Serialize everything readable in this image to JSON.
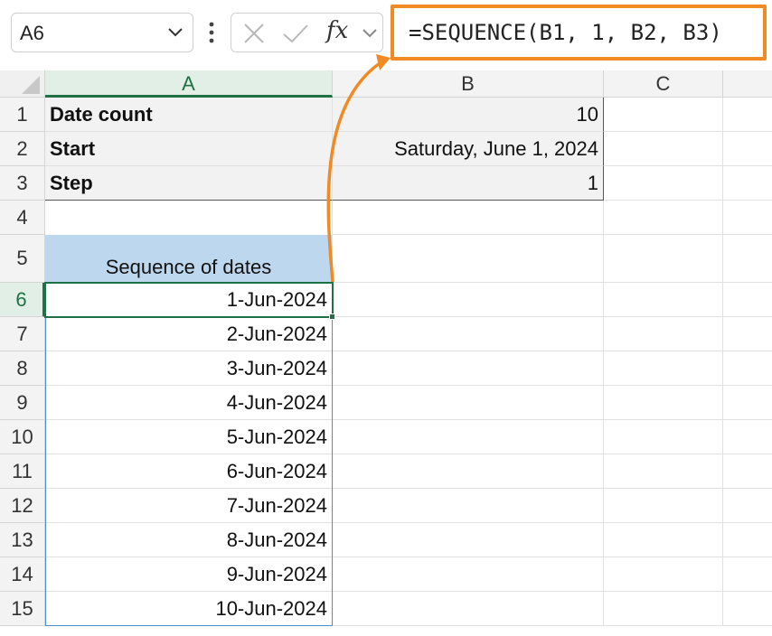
{
  "formula_bar": {
    "name_box": "A6",
    "fx_label": "fx",
    "formula": "=SEQUENCE(B1, 1, B2, B3)"
  },
  "columns": [
    "A",
    "B",
    "C"
  ],
  "rows": [
    "1",
    "2",
    "3",
    "4",
    "5",
    "6",
    "7",
    "8",
    "9",
    "10",
    "11",
    "12",
    "13",
    "14",
    "15"
  ],
  "cells": {
    "A1": "Date count",
    "B1": "10",
    "A2": "Start",
    "B2": "Saturday, June 1, 2024",
    "A3": "Step",
    "B3": "1",
    "A5": "Sequence of dates"
  },
  "sequence": [
    "1-Jun-2024",
    "2-Jun-2024",
    "3-Jun-2024",
    "4-Jun-2024",
    "5-Jun-2024",
    "6-Jun-2024",
    "7-Jun-2024",
    "8-Jun-2024",
    "9-Jun-2024",
    "10-Jun-2024"
  ],
  "colors": {
    "accent_orange": "#f08a24",
    "selection_green": "#1f7145",
    "header_blue": "#bdd7ee"
  }
}
